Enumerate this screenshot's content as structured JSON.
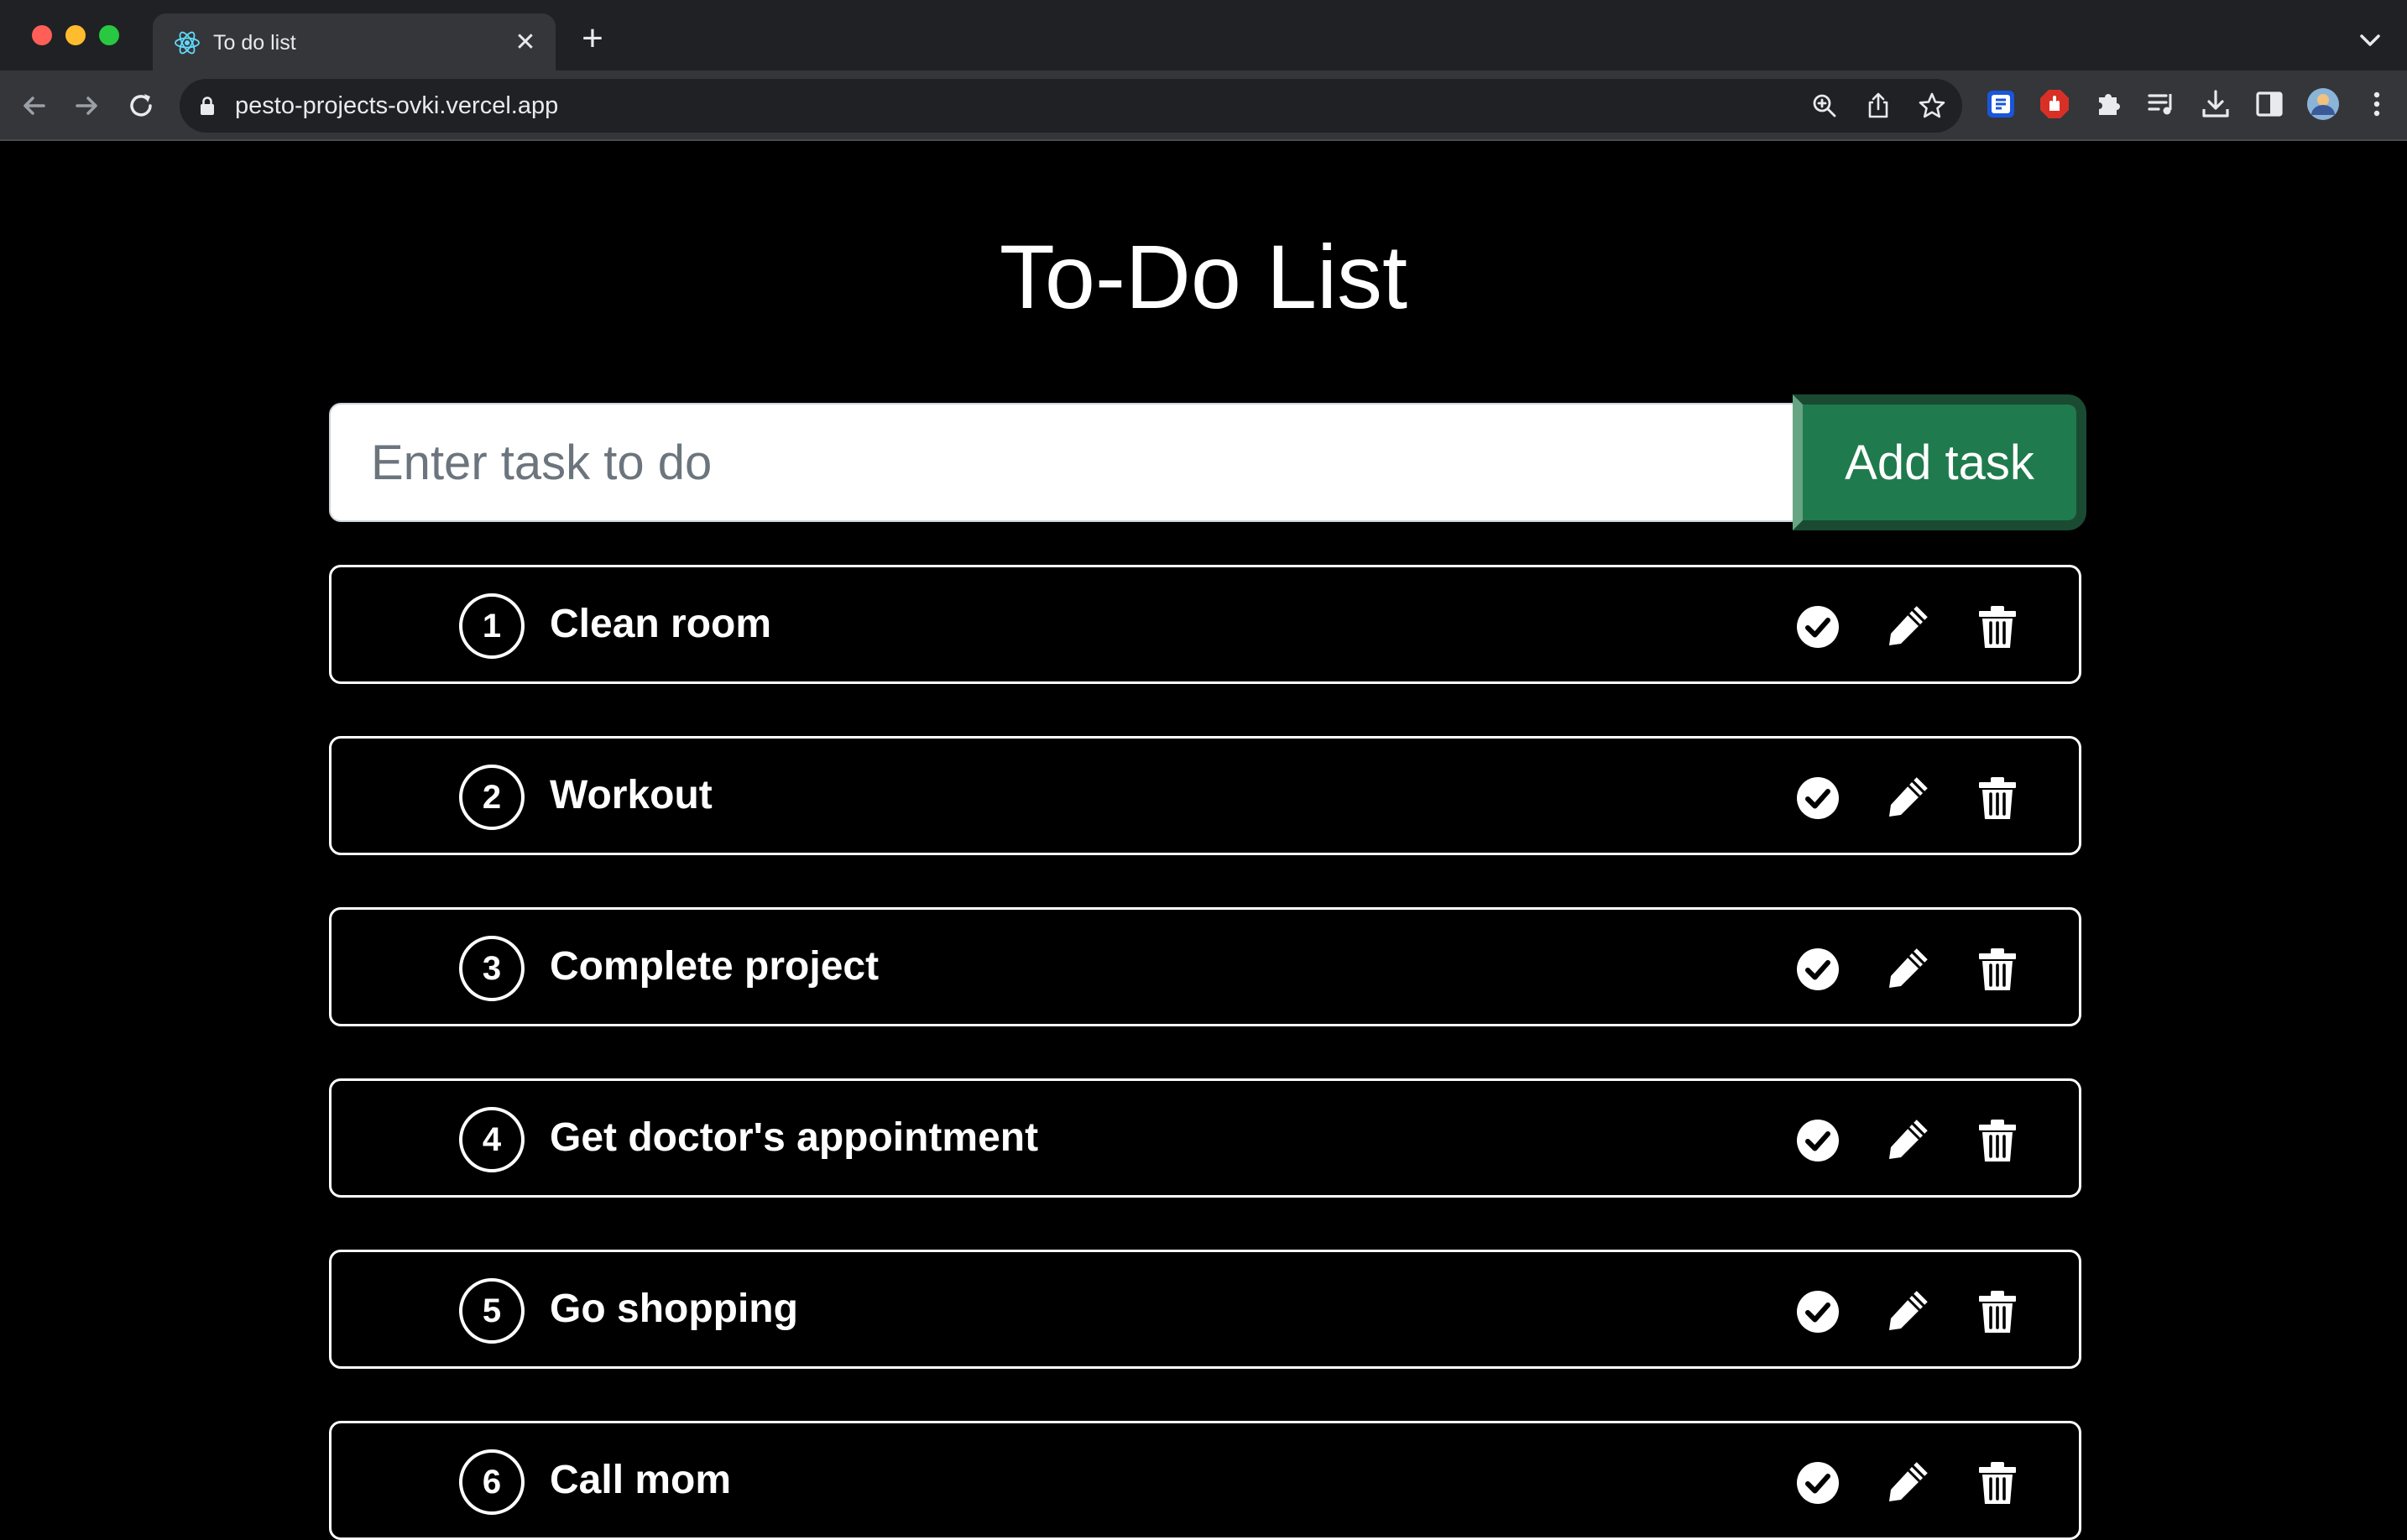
{
  "browser": {
    "tab_title": "To do list",
    "tab_close": "✕",
    "new_tab": "+",
    "url": "pesto-projects-ovki.vercel.app"
  },
  "page": {
    "title": "To-Do List",
    "input_placeholder": "Enter task to do",
    "add_button": "Add task"
  },
  "tasks": [
    {
      "num": "1",
      "text": "Clean room"
    },
    {
      "num": "2",
      "text": "Workout"
    },
    {
      "num": "3",
      "text": "Complete project"
    },
    {
      "num": "4",
      "text": "Get doctor's appointment"
    },
    {
      "num": "5",
      "text": "Go shopping"
    },
    {
      "num": "6",
      "text": "Call mom"
    }
  ],
  "colors": {
    "background": "#000000",
    "add_button": "#1f7b4d",
    "tab_bar": "#202124",
    "toolbar": "#35363a"
  }
}
